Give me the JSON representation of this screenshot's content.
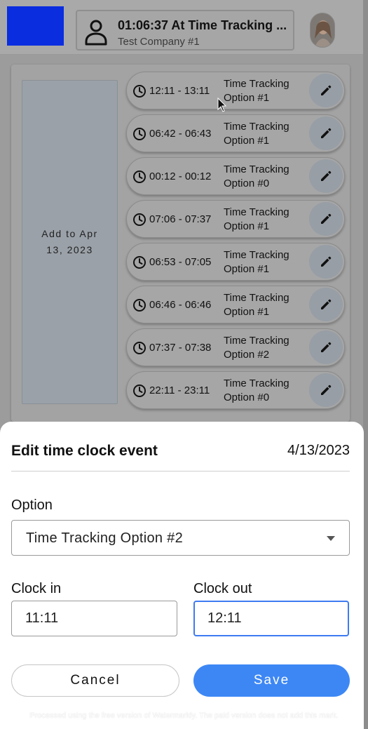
{
  "header": {
    "status_title": "01:06:37 At Time Tracking ...",
    "company": "Test Company #1",
    "logo_color": "#0a2de0",
    "icons": [
      "person-icon",
      "avatar"
    ]
  },
  "panel": {
    "add_to": "Add to Apr 13, 2023",
    "events": [
      {
        "time": "12:11 - 13:11",
        "label": "Time Tracking Option #1"
      },
      {
        "time": "06:42 - 06:43",
        "label": "Time Tracking Option #1"
      },
      {
        "time": "00:12 - 00:12",
        "label": "Time Tracking Option #0"
      },
      {
        "time": "07:06 - 07:37",
        "label": "Time Tracking Option #1"
      },
      {
        "time": "06:53 - 07:05",
        "label": "Time Tracking Option #1"
      },
      {
        "time": "06:46 - 06:46",
        "label": "Time Tracking Option #1"
      },
      {
        "time": "07:37 - 07:38",
        "label": "Time Tracking Option #2"
      },
      {
        "time": "22:11 - 23:11",
        "label": "Time Tracking Option #0"
      }
    ]
  },
  "sheet": {
    "title": "Edit time clock event",
    "date": "4/13/2023",
    "option_label": "Option",
    "option_value": "Time Tracking Option #2",
    "clock_in_label": "Clock in",
    "clock_in_value": "11:11",
    "clock_out_label": "Clock out",
    "clock_out_value": "12:11",
    "cancel_label": "Cancel",
    "save_label": "Save",
    "accent_color": "#3d87f5"
  },
  "watermark": "Processed using the free version of Watermarkly. The paid version does not add this mark."
}
